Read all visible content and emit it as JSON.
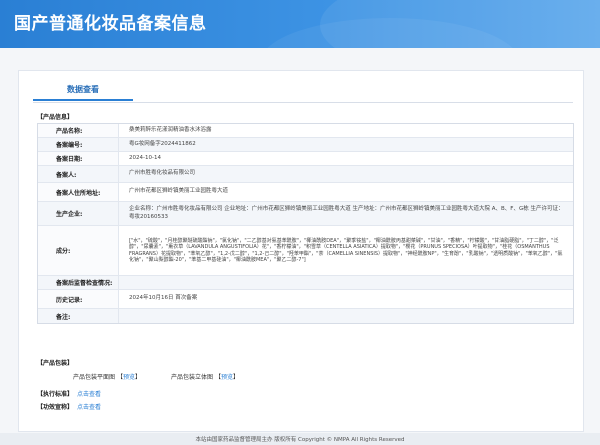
{
  "header": {
    "title": "国产普通化妆品备案信息"
  },
  "tabs": {
    "active": "数据查看"
  },
  "product_info": {
    "section_title": "【产品信息】",
    "rows": [
      {
        "label": "产品名称:",
        "value": "桑美莉醉乐花漾润精油香水沐浴露"
      },
      {
        "label": "备案编号:",
        "value": "粤G妆网备字2024411862"
      },
      {
        "label": "备案日期:",
        "value": "2024-10-14"
      },
      {
        "label": "备案人:",
        "value": "广州市胜粤化妆品有限公司"
      },
      {
        "label": "备案人住所地址:",
        "value": "广州市花都区狮岭镇美丽工业园胜粤大道"
      },
      {
        "label": "生产企业:",
        "value": "企业名称：广州市胜粤化妆品有限公司 企业地址：广州市花都区狮岭镇美丽工业园胜粤大道 生产地址：广州市花都区狮岭镇美丽工业园胜粤大道大院 A、B、F、G栋 生产许可证：粤妆20160533"
      },
      {
        "label": "成分:",
        "value": "[\"水\"，\"硫酸\"，\"月桂醇聚醚硫酸酯钠\"，\"氯化钠\"，\"二乙醇基对氨基苯酰胺\"，\"椰油酰胺DEA\"，\"聚季铵盐\"，\"椰油酰胺丙基甜菜碱\"，\"甘油\"，\"香精\"，\"柠檬酸\"，\"甘油脂硬脂\"，\"丁二醇\"，\"泛醇\"，\"尿囊素\"，\"薰衣草（LAVANDULA ANGUSTIFOLIA）花\"，\"香柠檬油\"，\"积雪草（CENTELLA ASIATICA）提取物\"，\"樱花（PRUNUS SPECIOSA）叶提取物\"，\"桂花（OSMANTHUS FRAGRANS）花提取物\"，\"苯氧乙醇\"，\"1,2-戊二醇\"，\"1,2-己二醇\"，\"羟苯甲酯\"，\"茶（CAMELLIA SINENSIS）提取物\"，\"神经酰胺NP\"，\"生育酚\"，\"乳酸钠\"，\"透明质酸钠\"，\"苯氧乙醇\"，\"氯化钠\"，\"聚山梨醇酯-20\"，\"苯基二甲基硅油\"，\"椰油酰胺MEA\"，\"聚乙二醇-7\"]"
      },
      {
        "label": "备案后监督检查情况:",
        "value": ""
      },
      {
        "label": "历史记录:",
        "value": "2024年10月16日 首次备案"
      },
      {
        "label": "备注:",
        "value": ""
      }
    ]
  },
  "package": {
    "section_title": "【产品包装】",
    "flat_label": "产品包装平面图",
    "flat_link": "预览",
    "solid_label": "产品包装立体图",
    "solid_link": "预览"
  },
  "standard": {
    "section_title": "【执行标准】",
    "link": "点击查看"
  },
  "efficacy": {
    "section_title": "【功效宣称】",
    "link": "点击查看"
  },
  "footer": {
    "text": "本站由国家药品监督管理局主办 版权所有 Copyright © NMPA All Rights Reserved"
  }
}
